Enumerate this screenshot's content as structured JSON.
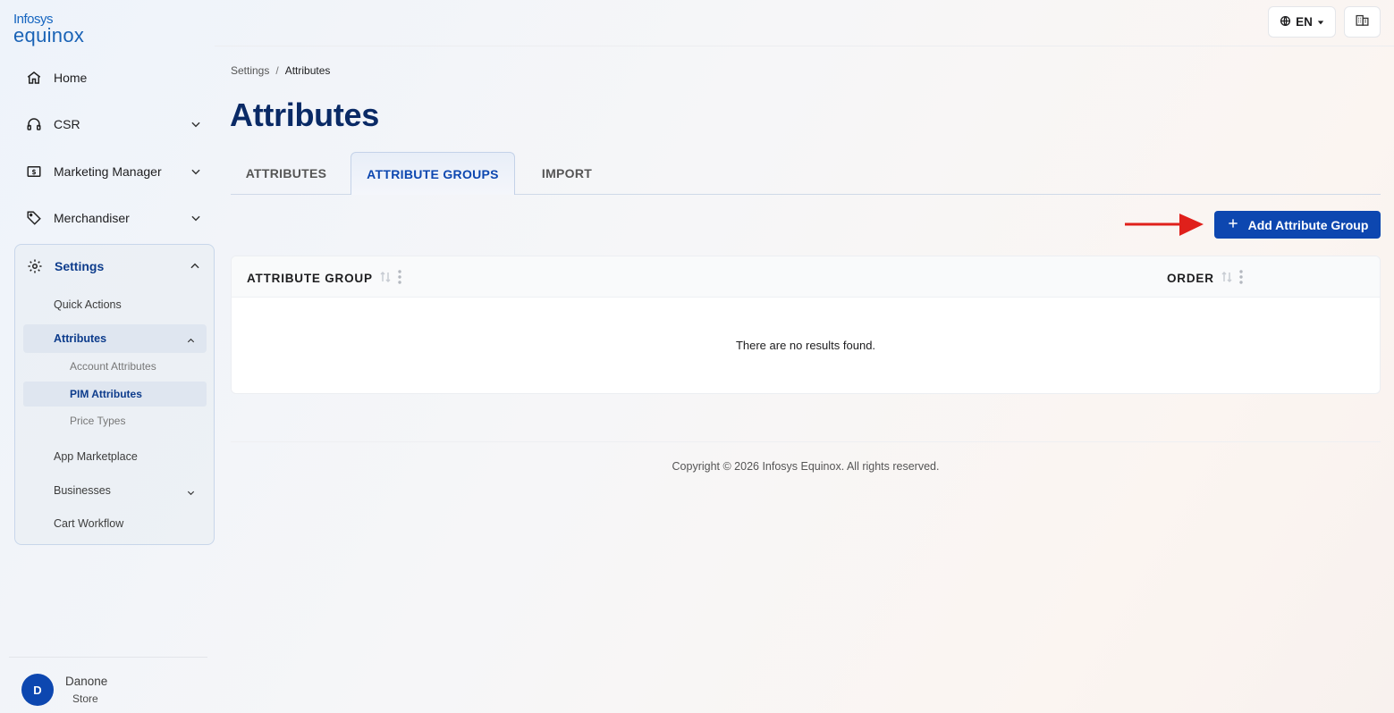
{
  "logo": {
    "line1": "Infosys",
    "line2": "equinox"
  },
  "sidebar": {
    "items": [
      {
        "label": "Home",
        "icon": "home-icon"
      },
      {
        "label": "CSR",
        "icon": "headset-icon"
      },
      {
        "label": "Marketing Manager",
        "icon": "dollar-box-icon"
      },
      {
        "label": "Merchandiser",
        "icon": "tag-icon"
      }
    ],
    "settings": {
      "label": "Settings",
      "icon": "gear-icon",
      "children": {
        "quick_actions": "Quick Actions",
        "attributes": "Attributes",
        "account_attributes": "Account Attributes",
        "pim_attributes": "PIM Attributes",
        "price_types": "Price Types",
        "app_marketplace": "App Marketplace",
        "businesses": "Businesses",
        "cart_workflow": "Cart Workflow"
      }
    },
    "user": {
      "initial": "D",
      "name": "Danone",
      "store": "Store"
    }
  },
  "topbar": {
    "language": "EN"
  },
  "breadcrumb": {
    "parent": "Settings",
    "separator": "/",
    "current": "Attributes"
  },
  "page": {
    "title": "Attributes"
  },
  "tabs": [
    {
      "label": "ATTRIBUTES"
    },
    {
      "label": "ATTRIBUTE GROUPS",
      "active": true
    },
    {
      "label": "IMPORT"
    }
  ],
  "actions": {
    "add_label": "Add Attribute Group"
  },
  "table": {
    "columns": [
      "ATTRIBUTE GROUP",
      "ORDER"
    ],
    "empty_message": "There are no results found."
  },
  "footer": {
    "copyright": "Copyright © 2026 Infosys Equinox. All rights reserved."
  },
  "colors": {
    "primary": "#0d47b0",
    "title": "#0a2a66",
    "arrow": "#e0201b"
  }
}
